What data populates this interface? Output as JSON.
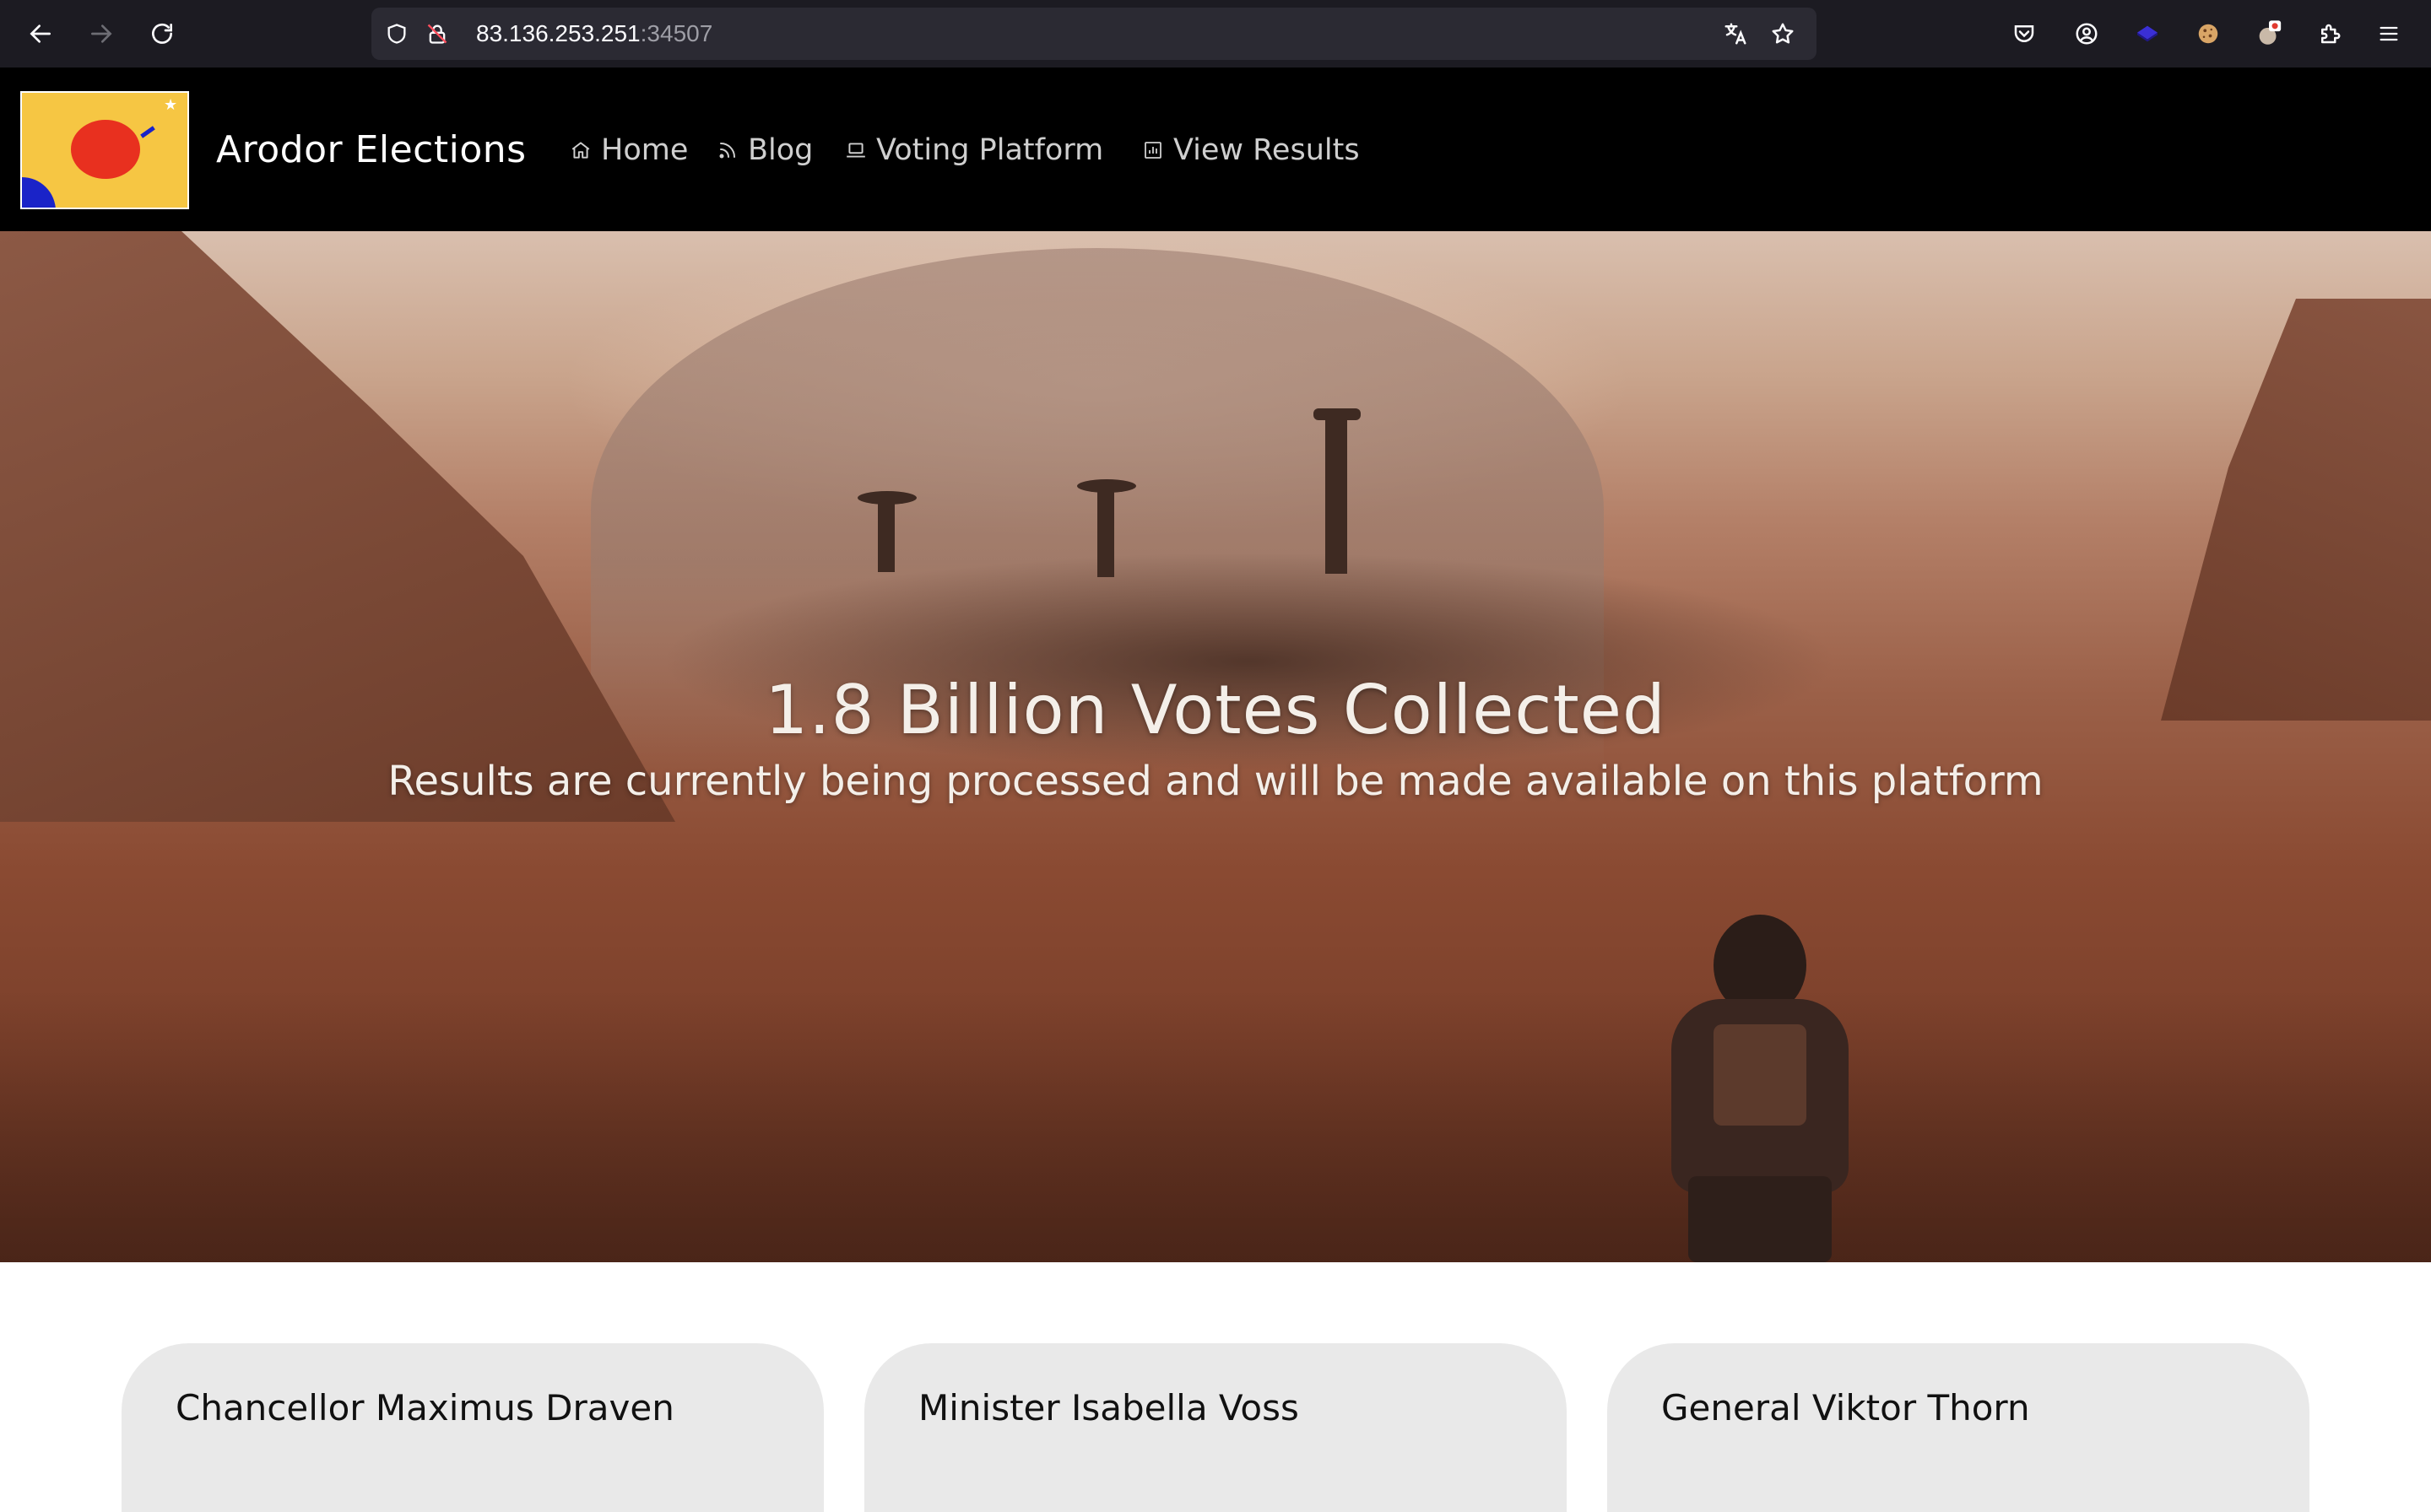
{
  "browser": {
    "url_host": "83.136.253.251",
    "url_port": ":34507"
  },
  "site": {
    "title": "Arodor Elections",
    "nav": [
      {
        "label": "Home",
        "icon": "home-icon"
      },
      {
        "label": "Blog",
        "icon": "rss-icon"
      },
      {
        "label": "Voting Platform",
        "icon": "laptop-icon"
      },
      {
        "label": "View Results",
        "icon": "chart-icon"
      }
    ]
  },
  "hero": {
    "title": "1.8 Billion Votes Collected",
    "subtitle": "Results are currently being processed and will be made available on this platform"
  },
  "candidates": [
    {
      "name": "Chancellor Maximus Draven"
    },
    {
      "name": "Minister Isabella Voss"
    },
    {
      "name": "General Viktor Thorn"
    }
  ],
  "colors": {
    "header_bg": "#000000",
    "logo_bg": "#f6c643",
    "logo_sun": "#e8301f",
    "card_bg": "#e9e9e9"
  }
}
